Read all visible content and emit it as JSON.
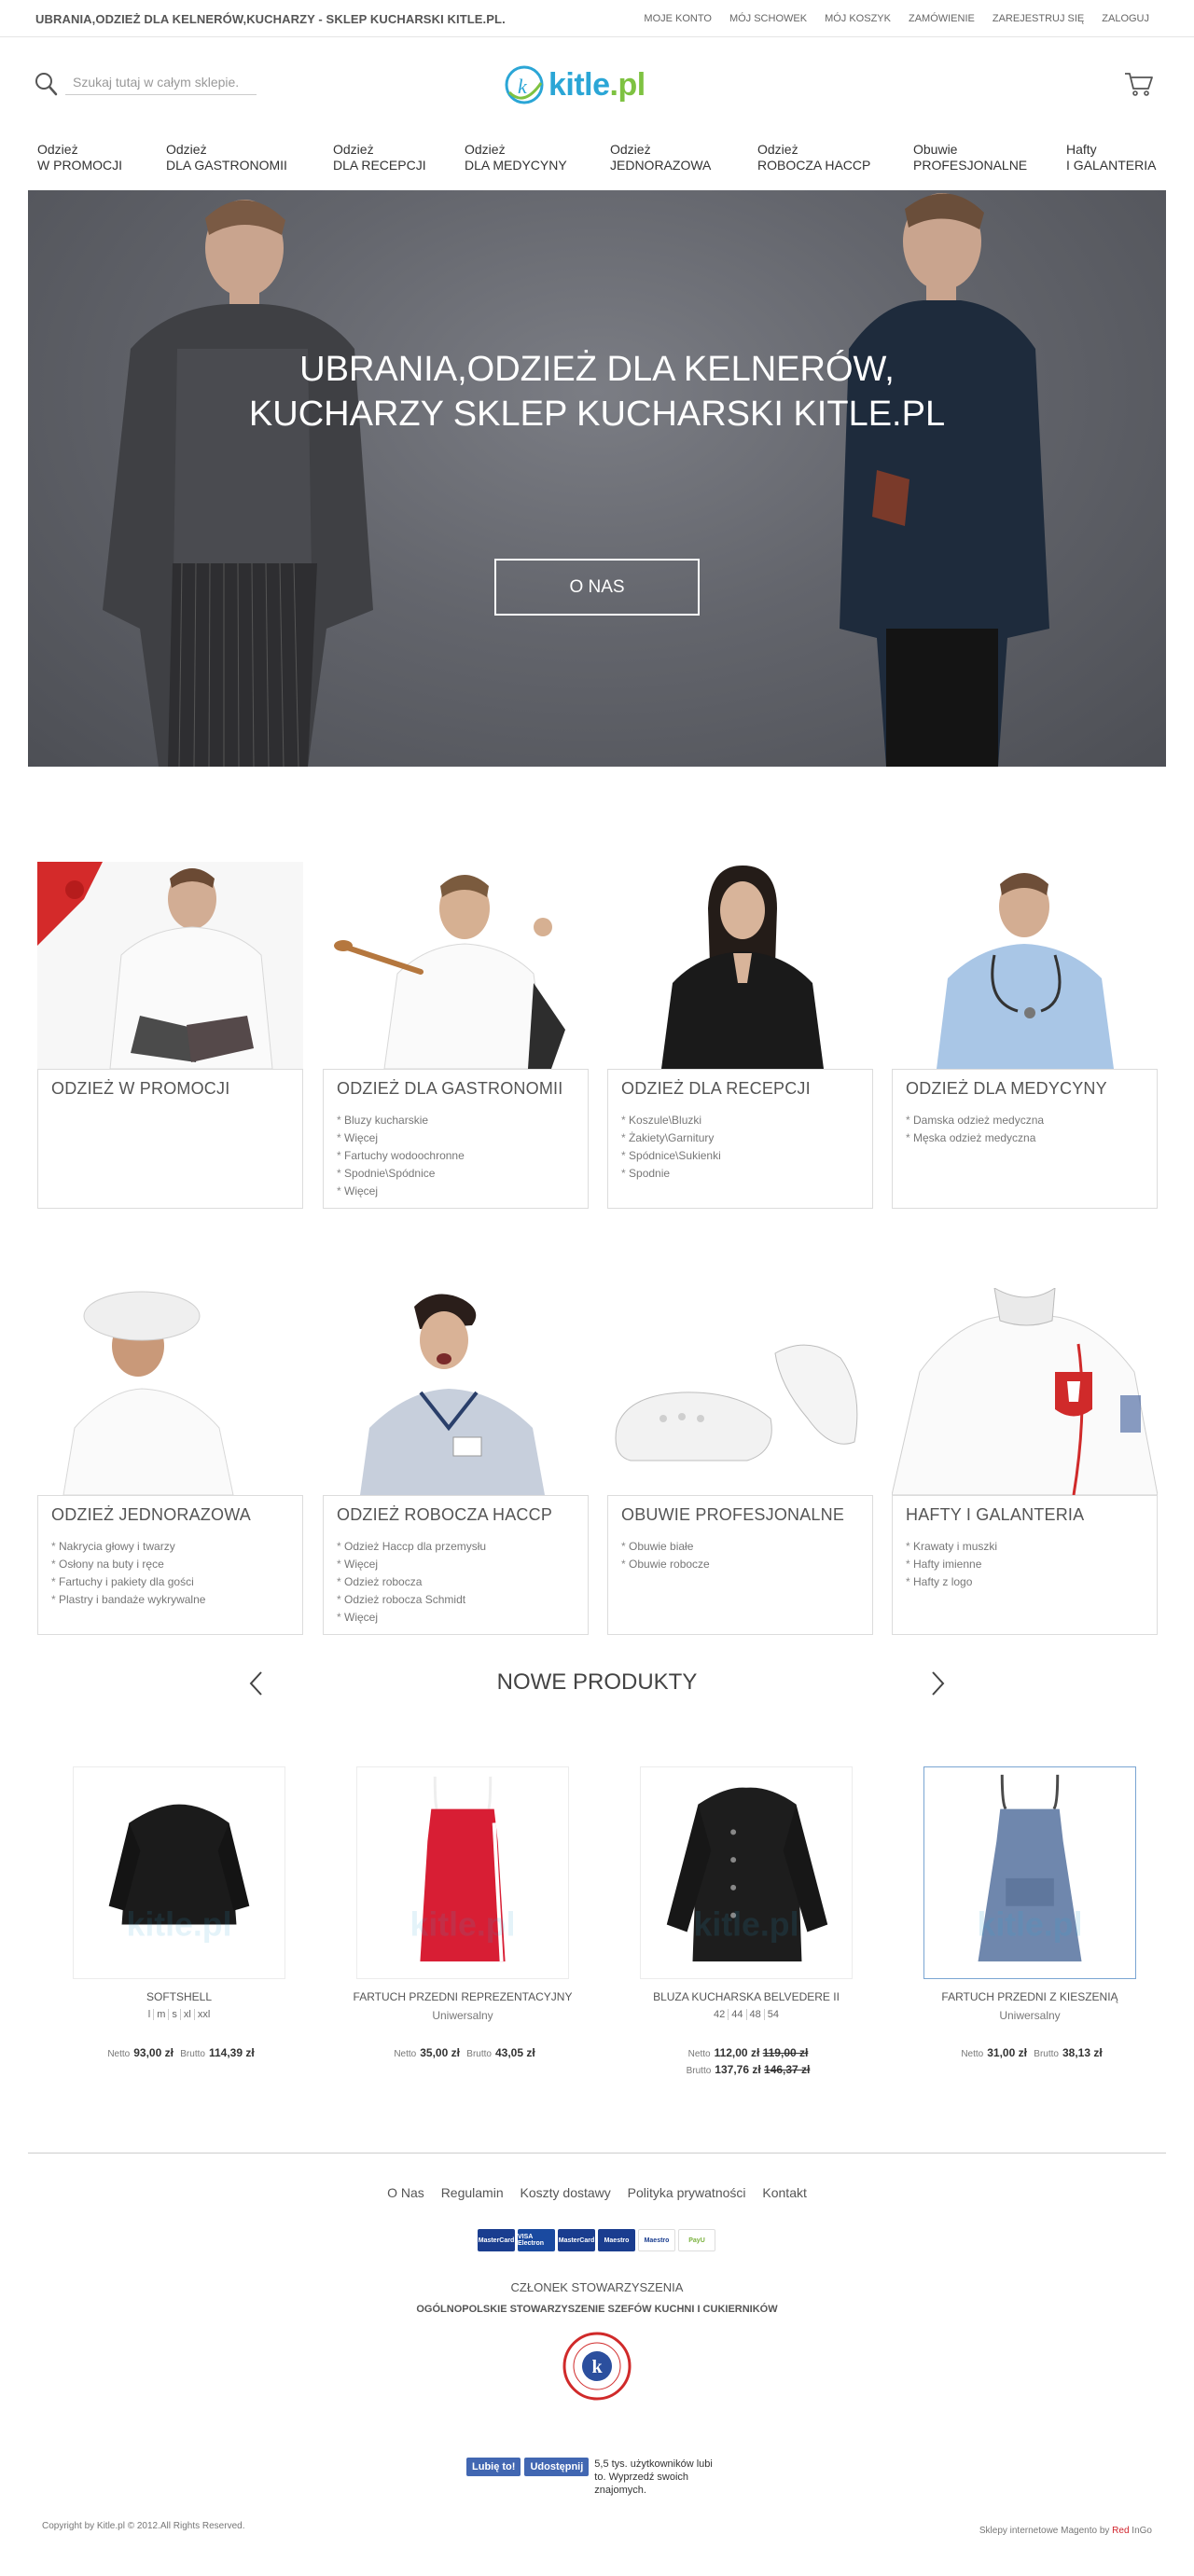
{
  "topbar": {
    "site_title": "UBRANIA,ODZIEŻ DLA KELNERÓW,KUCHARZY - SKLEP KUCHARSKI KITLE.PL.",
    "links": [
      "MOJE KONTO",
      "MÓJ SCHOWEK",
      "MÓJ KOSZYK",
      "ZAMÓWIENIE",
      "ZAREJESTRUJ SIĘ",
      "ZALOGUJ"
    ]
  },
  "header": {
    "search_placeholder": "Szukaj tutaj w całym sklepie.",
    "logo_main": "kitle",
    "logo_tld": ".pl"
  },
  "nav": [
    {
      "line1": "Odzież",
      "line2": "W PROMOCJI"
    },
    {
      "line1": "Odzież",
      "line2": "DLA GASTRONOMII"
    },
    {
      "line1": "Odzież",
      "line2": "DLA RECEPCJI"
    },
    {
      "line1": "Odzież",
      "line2": "DLA MEDYCYNY"
    },
    {
      "line1": "Odzież",
      "line2": "JEDNORAZOWA"
    },
    {
      "line1": "Odzież",
      "line2": "ROBOCZA HACCP"
    },
    {
      "line1": "Obuwie",
      "line2": "PROFESJONALNE"
    },
    {
      "line1": "Hafty",
      "line2": "I GALANTERIA"
    }
  ],
  "hero": {
    "title_line1": "UBRANIA,ODZIEŻ DLA KELNERÓW,",
    "title_line2": "KUCHARZY SKLEP KUCHARSKI KITLE.PL",
    "button": "O NAS"
  },
  "categories": [
    {
      "title": "ODZIEŻ W PROMOCJI",
      "items": []
    },
    {
      "title": "ODZIEŻ DLA GASTRONOMII",
      "items": [
        "Bluzy kucharskie",
        "Więcej",
        "Fartuchy wodoochronne",
        "Spodnie\\Spódnice",
        "Więcej"
      ]
    },
    {
      "title": "ODZIEŻ DLA RECEPCJI",
      "items": [
        "Koszule\\Bluzki",
        "Żakiety\\Garnitury",
        "Spódnice\\Sukienki",
        "Spodnie"
      ]
    },
    {
      "title": "ODZIEŻ DLA MEDYCYNY",
      "items": [
        "Damska odzież medyczna",
        "Męska odzież medyczna"
      ]
    },
    {
      "title": "ODZIEŻ JEDNORAZOWA",
      "items": [
        "Nakrycia głowy i twarzy",
        "Osłony na buty i ręce",
        "Fartuchy i pakiety dla gości",
        "Plastry i bandaże wykrywalne"
      ]
    },
    {
      "title": "ODZIEŻ ROBOCZA HACCP",
      "items": [
        "Odzież Haccp dla przemysłu",
        "Więcej",
        "Odzież robocza",
        "Odzież robocza Schmidt",
        "Więcej"
      ]
    },
    {
      "title": "OBUWIE PROFESJONALNE",
      "items": [
        "Obuwie białe",
        "Obuwie robocze"
      ]
    },
    {
      "title": "HAFTY I GALANTERIA",
      "items": [
        "Krawaty i muszki",
        "Hafty imienne",
        "Hafty z logo"
      ]
    }
  ],
  "new_products": {
    "title": "NOWE PRODUKTY",
    "items": [
      {
        "name": "SOFTSHELL",
        "sizes": [
          "l",
          "m",
          "s",
          "xl",
          "xxl"
        ],
        "variant": "",
        "netto_label": "Netto",
        "netto": "93,00 zł",
        "brutto_label": "Brutto",
        "brutto": "114,39 zł"
      },
      {
        "name": "FARTUCH PRZEDNI REPREZENTACYJNY",
        "sizes": [],
        "variant": "Uniwersalny",
        "netto_label": "Netto",
        "netto": "35,00 zł",
        "brutto_label": "Brutto",
        "brutto": "43,05 zł"
      },
      {
        "name": "BLUZA KUCHARSKA BELVEDERE II",
        "sizes": [
          "42",
          "44",
          "48",
          "54"
        ],
        "variant": "",
        "netto_label": "Netto",
        "netto": "112,00 zł",
        "netto_old": "119,00 zł",
        "brutto_label": "Brutto",
        "brutto": "137,76 zł",
        "brutto_old": "146,37 zł"
      },
      {
        "name": "FARTUCH PRZEDNI Z KIESZENIĄ",
        "sizes": [],
        "variant": "Uniwersalny",
        "netto_label": "Netto",
        "netto": "31,00 zł",
        "brutto_label": "Brutto",
        "brutto": "38,13 zł"
      }
    ]
  },
  "footer": {
    "links": [
      "O Nas",
      "Regulamin",
      "Koszty dostawy",
      "Polityka prywatności",
      "Kontakt"
    ],
    "payments": [
      "MasterCard",
      "VISA Electron",
      "MasterCard",
      "Maestro",
      "Maestro",
      "PayU"
    ],
    "member_title": "CZŁONEK STOWARZYSZENIA",
    "member_org": "OGÓLNOPOLSKIE STOWARZYSZENIE SZEFÓW KUCHNI I CUKIERNIKÓW",
    "fb_like": "Lubię to!",
    "fb_share": "Udostępnij",
    "fb_text": "5,5 tys. użytkowników lubi to. Wyprzedź swoich znajomych.",
    "copyright": "Copyright by Kitle.pl © 2012.All Rights Reserved.",
    "powered_prefix": "Sklepy internetowe Magento by ",
    "powered_red": "Red",
    "powered_suffix": " InGo"
  },
  "colors": {
    "brand_blue": "#2ba6d6",
    "brand_green": "#7ec241",
    "hero_bg": "#63656c"
  }
}
